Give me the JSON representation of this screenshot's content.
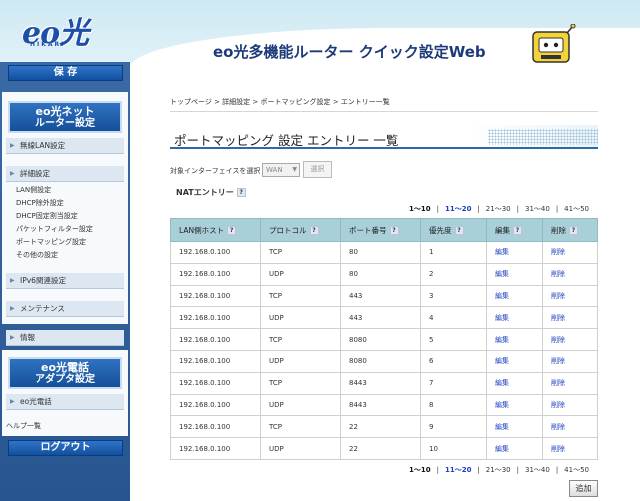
{
  "header": {
    "logo_text": "eo光",
    "logo_sub": "HIKARI",
    "title": "eo光多機能ルーター クイック設定Web"
  },
  "sidebar": {
    "save_label": "保 存",
    "router_settings_l1": "eo光ネット",
    "router_settings_l2": "ルーター設定",
    "sections": {
      "wireless": "無線LAN設定",
      "details": "詳細設定",
      "ipv6": "IPv6関連設定",
      "maintenance": "メンテナンス",
      "info": "情報",
      "eo_phone": "eo光電話"
    },
    "detail_links": [
      "LAN側設定",
      "DHCP除外設定",
      "DHCP固定割当設定",
      "パケットフィルター設定",
      "ポートマッピング設定",
      "その他の設定"
    ],
    "phone_adapter_l1": "eo光電話",
    "phone_adapter_l2": "アダプタ設定",
    "help": "ヘルプ一覧",
    "logout_label": "ログアウト"
  },
  "breadcrumb": "トップページ > 詳細設定 > ポートマッピング設定 > エントリー一覧",
  "page_title": "ポートマッピング 設定 エントリー 一覧",
  "interface": {
    "label": "対象インターフェイスを選択",
    "selected": "WAN",
    "select_button": "選択"
  },
  "nat_title": "NATエントリー",
  "help_mark": "?",
  "pager": {
    "pages": [
      "1〜10",
      "11〜20",
      "21〜30",
      "31〜40",
      "41〜50"
    ],
    "separator": "|"
  },
  "table": {
    "headers": [
      "LAN側ホスト",
      "プロトコル",
      "ポート番号",
      "優先度",
      "編集",
      "削除"
    ],
    "edit_label": "編集",
    "delete_label": "削除",
    "rows": [
      {
        "host": "192.168.0.100",
        "protocol": "TCP",
        "port": "80",
        "priority": "1"
      },
      {
        "host": "192.168.0.100",
        "protocol": "UDP",
        "port": "80",
        "priority": "2"
      },
      {
        "host": "192.168.0.100",
        "protocol": "TCP",
        "port": "443",
        "priority": "3"
      },
      {
        "host": "192.168.0.100",
        "protocol": "UDP",
        "port": "443",
        "priority": "4"
      },
      {
        "host": "192.168.0.100",
        "protocol": "TCP",
        "port": "8080",
        "priority": "5"
      },
      {
        "host": "192.168.0.100",
        "protocol": "UDP",
        "port": "8080",
        "priority": "6"
      },
      {
        "host": "192.168.0.100",
        "protocol": "TCP",
        "port": "8443",
        "priority": "7"
      },
      {
        "host": "192.168.0.100",
        "protocol": "UDP",
        "port": "8443",
        "priority": "8"
      },
      {
        "host": "192.168.0.100",
        "protocol": "TCP",
        "port": "22",
        "priority": "9"
      },
      {
        "host": "192.168.0.100",
        "protocol": "UDP",
        "port": "22",
        "priority": "10"
      }
    ]
  },
  "add_button": "追加",
  "colors": {
    "accent": "#2b6aa5",
    "table_header": "#a9cfd9",
    "link": "#1f3fbf",
    "sidebar": "#27558f"
  }
}
